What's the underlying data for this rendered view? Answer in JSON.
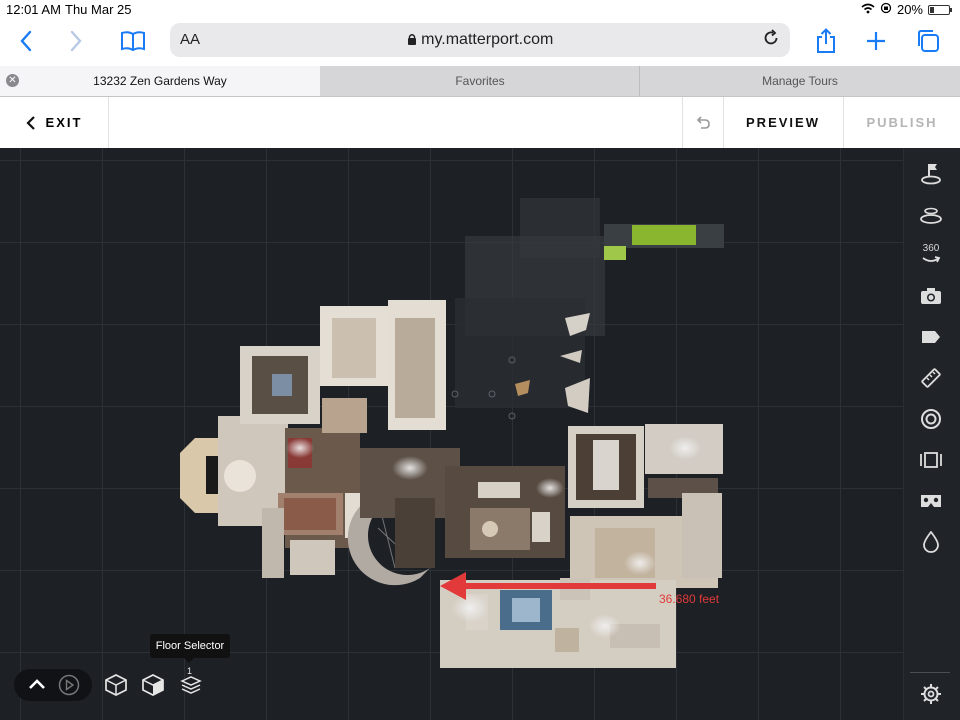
{
  "status_bar": {
    "time": "12:01 AM",
    "date": "Thu Mar 25",
    "battery": "20%",
    "battery_level": 0.2
  },
  "browser": {
    "text_size_label": "AA",
    "url": "my.matterport.com",
    "icons": [
      "back-icon",
      "forward-icon",
      "bookmarks-icon",
      "lock-icon",
      "reload-icon",
      "share-icon",
      "new-tab-icon",
      "tabs-icon"
    ]
  },
  "tabs": [
    {
      "label": "13232 Zen Gardens Way",
      "active": true
    },
    {
      "label": "Favorites",
      "active": false
    },
    {
      "label": "Manage Tours",
      "active": false
    }
  ],
  "header": {
    "exit_label": "EXIT",
    "preview_label": "PREVIEW",
    "publish_label": "PUBLISH"
  },
  "colors": {
    "accent": "#1a7cf5",
    "annotation": "#e23a3a",
    "canvas": "#1d2025",
    "publish_disabled": "#b5b5b5"
  },
  "annotation": {
    "measurement_label": "36.680 feet"
  },
  "right_toolbar": [
    "start-location-icon",
    "floor-plan-icon",
    "360-view-icon",
    "photo-icon",
    "tag-icon",
    "measure-icon",
    "mattertag-icon",
    "highlight-reel-icon",
    "vr-icon",
    "labels-icon",
    "settings-icon"
  ],
  "toolbar_360_label": "360",
  "bottom": {
    "tooltip": "Floor Selector",
    "floor_count": "1"
  }
}
